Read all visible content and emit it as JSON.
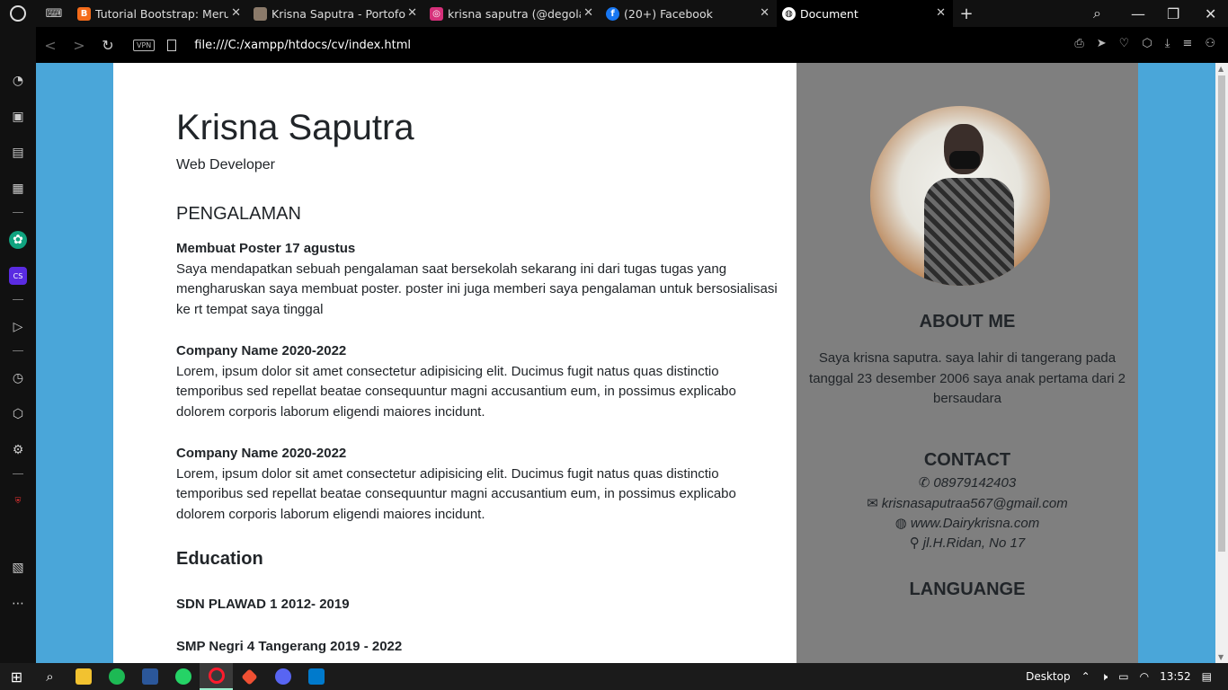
{
  "browser": {
    "tabs": [
      {
        "title": "Tutorial Bootstrap: Merubah",
        "color": "#f46b1a",
        "glyph": "B"
      },
      {
        "title": "Krisna Saputra - Portofolio",
        "color": "#8b7a6a",
        "glyph": ""
      },
      {
        "title": "krisna saputra (@degolasli",
        "color": "#d6307a",
        "glyph": "◎"
      },
      {
        "title": "(20+) Facebook",
        "color": "#1877f2",
        "glyph": "f"
      },
      {
        "title": "Document",
        "color": "#ffffff",
        "glyph": ""
      }
    ],
    "vpn_label": "VPN",
    "url": "file:///C:/xampp/htdocs/cv/index.html"
  },
  "cv": {
    "name": "Krisna Saputra",
    "role": "Web Developer",
    "experience_title": "PENGALAMAN",
    "jobs": [
      {
        "title": "Membuat Poster 17 agustus",
        "desc": "Saya mendapatkan sebuah pengalaman saat bersekolah sekarang ini dari tugas tugas yang mengharuskan saya membuat poster. poster ini juga memberi saya pengalaman untuk bersosialisasi ke rt tempat saya tinggal"
      },
      {
        "title": "Company Name 2020-2022",
        "desc": "Lorem, ipsum dolor sit amet consectetur adipisicing elit. Ducimus fugit natus quas distinctio temporibus sed repellat beatae consequuntur magni accusantium eum, in possimus explicabo dolorem corporis laborum eligendi maiores incidunt."
      },
      {
        "title": "Company Name 2020-2022",
        "desc": "Lorem, ipsum dolor sit amet consectetur adipisicing elit. Ducimus fugit natus quas distinctio temporibus sed repellat beatae consequuntur magni accusantium eum, in possimus explicabo dolorem corporis laborum eligendi maiores incidunt."
      }
    ],
    "education_title": "Education",
    "education": [
      "SDN PLAWAD 1 2012- 2019",
      "SMP Negri 4 Tangerang 2019 - 2022"
    ],
    "about_title": "ABOUT ME",
    "about_text": "Saya krisna saputra. saya lahir di tangerang pada tanggal 23 desember 2006 saya anak pertama dari 2 bersaudara",
    "contact_title": "CONTACT",
    "contacts": [
      {
        "icon": "phone-icon",
        "text": "08979142403"
      },
      {
        "icon": "envelope-icon",
        "text": "krisnasaputraa567@gmail.com"
      },
      {
        "icon": "globe-icon",
        "text": "www.Dairykrisna.com"
      },
      {
        "icon": "map-pin-icon",
        "text": "jl.H.Ridan, No 17"
      }
    ],
    "language_title": "LANGUANGE"
  },
  "taskbar": {
    "desktop_label": "Desktop",
    "time": "13:52"
  }
}
